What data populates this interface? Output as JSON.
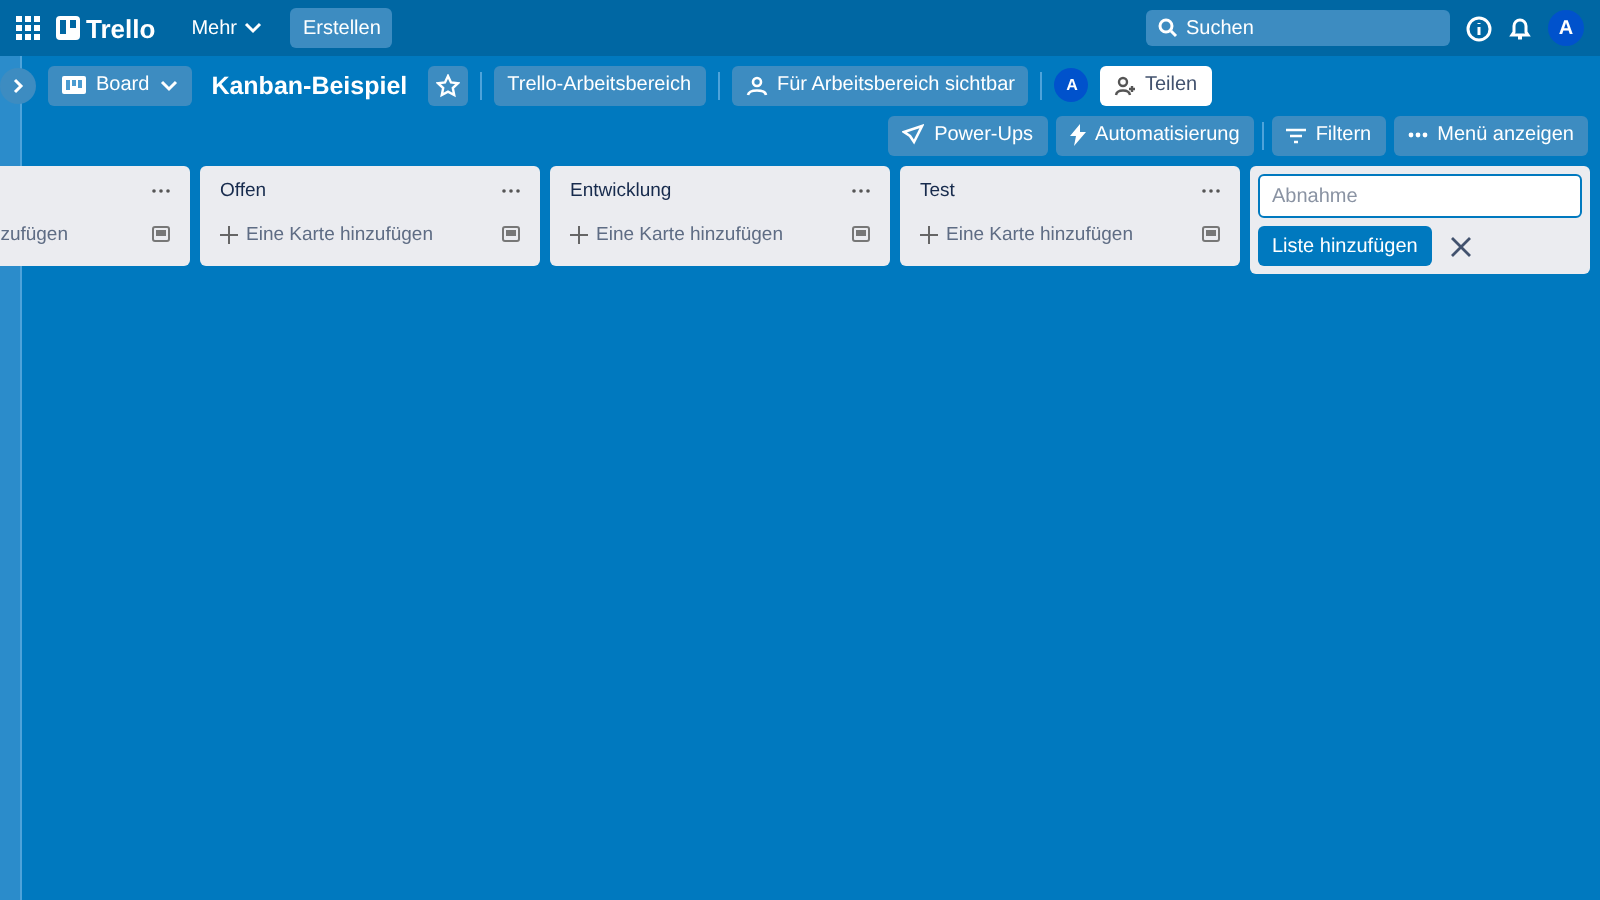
{
  "topbar": {
    "logo": "Trello",
    "more": "Mehr",
    "create": "Erstellen",
    "search": {
      "placeholder": "Suchen"
    },
    "avatar": "A"
  },
  "board_header": {
    "view": "Board",
    "title": "Kanban-Beispiel",
    "starred": false,
    "workspace": "Trello-Arbeitsbereich",
    "visibility": "Für Arbeitsbereich sichtbar",
    "member": "A",
    "share": "Teilen",
    "actions": [
      "Power-Ups",
      "Automatisierung",
      "Filtern",
      "Menü anzeigen"
    ]
  },
  "lists": [
    {
      "add_card": "zufügen"
    },
    {
      "title": "Offen",
      "add_card": "Eine Karte hinzufügen"
    },
    {
      "title": "Entwicklung",
      "add_card": "Eine Karte hinzufügen"
    },
    {
      "title": "Test",
      "add_card": "Eine Karte hinzufügen"
    }
  ],
  "new_list": {
    "placeholder": "Abnahme",
    "button": "Liste hinzufügen"
  }
}
